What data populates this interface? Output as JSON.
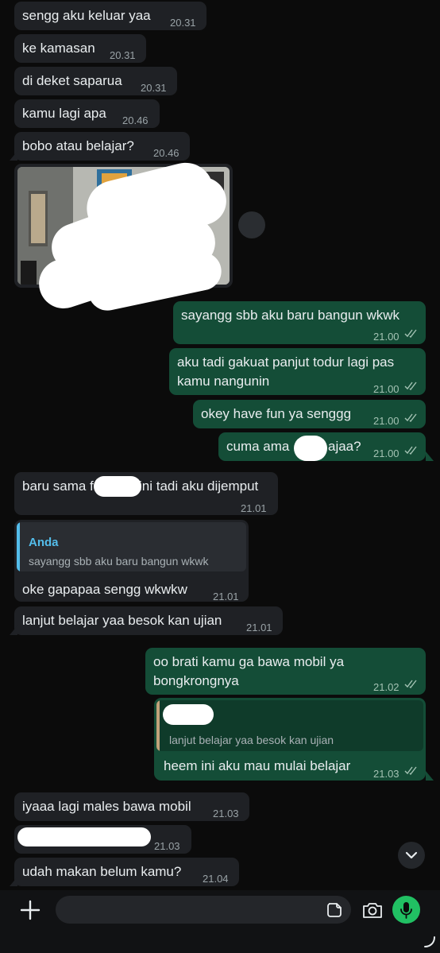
{
  "messages": [
    {
      "dir": "in",
      "text": "sengg aku keluar yaa",
      "time": "20.31"
    },
    {
      "dir": "in",
      "text": "ke kamasan",
      "time": "20.31"
    },
    {
      "dir": "in",
      "text": "di deket saparua",
      "time": "20.31"
    },
    {
      "dir": "in",
      "text": "kamu lagi apa",
      "time": "20.46"
    },
    {
      "dir": "in",
      "text": "bobo atau belajar?",
      "time": "20.46"
    },
    {
      "dir": "out",
      "text": "sayangg sbb aku baru bangun wkwk",
      "time": "21.00"
    },
    {
      "dir": "out",
      "text_line1": "aku tadi gakuat panjut todur lagi pas",
      "text_line2": "kamu nangunin",
      "time": "21.00"
    },
    {
      "dir": "out",
      "text": "okey have fun ya senggg",
      "time": "21.00"
    },
    {
      "dir": "out",
      "text_a": "cuma ama",
      "text_b": "ajaa?",
      "time": "21.00"
    },
    {
      "dir": "in",
      "text_a": "baru sama f",
      "text_b": "ini tadi aku dijemput",
      "time": "21.01"
    },
    {
      "dir": "in",
      "quote_name": "Anda",
      "quote_text": "sayangg sbb aku baru bangun wkwk",
      "text": "oke gapapaa sengg wkwkw",
      "time": "21.01"
    },
    {
      "dir": "in",
      "text": "lanjut belajar yaa besok kan ujian",
      "time": "21.01"
    },
    {
      "dir": "out",
      "text_line1": "oo brati kamu ga bawa mobil ya",
      "text_line2": "bongkrongnya",
      "time": "21.02"
    },
    {
      "dir": "out",
      "quote_text": "lanjut belajar yaa besok kan ujian",
      "text": "heem ini aku mau mulai belajar",
      "time": "21.03"
    },
    {
      "dir": "in",
      "text": "iyaaa lagi males bawa mobil",
      "time": "21.03"
    },
    {
      "dir": "in",
      "time": "21.03"
    },
    {
      "dir": "in",
      "text": "udah makan belum kamu?",
      "time": "21.04"
    }
  ],
  "colors": {
    "background": "#0b0b0b",
    "incoming_bubble": "#1f2125",
    "outgoing_bubble": "#144d37",
    "quote_name_incoming": "#53bdeb",
    "mic_button": "#21c063"
  },
  "icons": {
    "read_receipt": "double-check-icon",
    "scroll_down": "chevron-down-icon",
    "attach": "plus-icon",
    "sticker": "sticker-icon",
    "camera": "camera-icon",
    "mic": "mic-icon"
  }
}
